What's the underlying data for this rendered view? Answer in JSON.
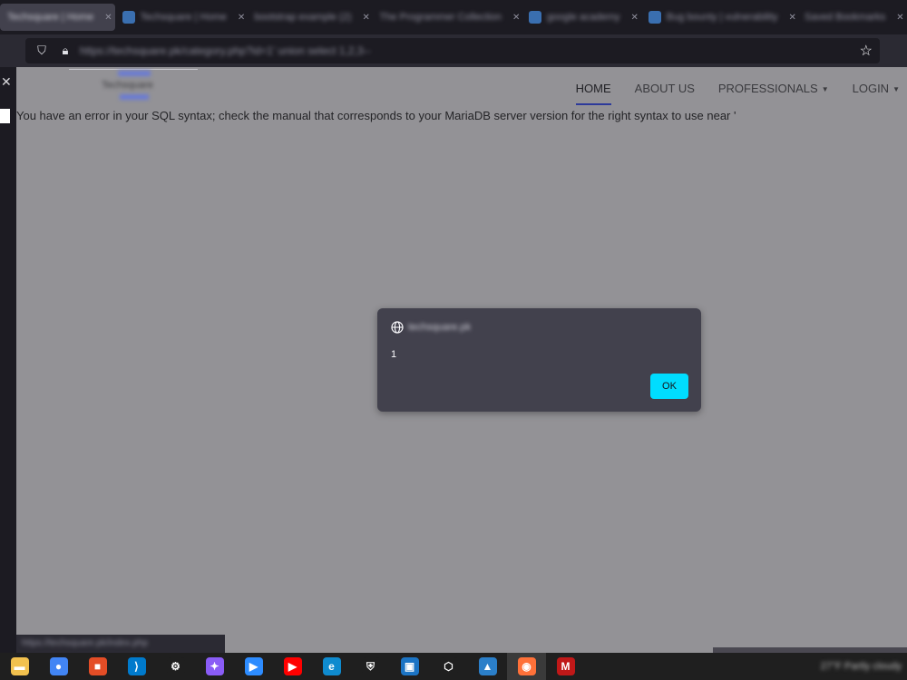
{
  "browser": {
    "tabs": [
      {
        "label": "Techsquare | Home",
        "active": true
      },
      {
        "label": "Techsquare | Home",
        "active": false
      },
      {
        "label": "bootstrap example (2)",
        "active": false
      },
      {
        "label": "The Programmer Collection",
        "active": false
      },
      {
        "label": "google academy",
        "active": false
      },
      {
        "label": "Bug bounty | vulnerability",
        "active": false
      },
      {
        "label": "Saved Bookmarks",
        "active": false
      }
    ],
    "url": "https://techsquare.pk/category.php?id=1' union select 1,2,3--",
    "page_status_url": "https://techsquare.pk/index.php"
  },
  "site": {
    "logo_text": "Techsquare",
    "nav": [
      {
        "label": "HOME",
        "dropdown": false,
        "active": true
      },
      {
        "label": "ABOUT US",
        "dropdown": false,
        "active": false
      },
      {
        "label": "PROFESSIONALS",
        "dropdown": true,
        "active": false
      },
      {
        "label": "LOGIN",
        "dropdown": true,
        "active": false
      }
    ],
    "error_message": "You have an error in your SQL syntax; check the manual that corresponds to your MariaDB server version for the right syntax to use near '"
  },
  "alert": {
    "origin": "techsquare.pk",
    "message": "1",
    "ok_label": "OK"
  },
  "taskbar": {
    "apps": [
      {
        "name": "file-explorer",
        "glyph": "▬",
        "color": "#f2c14e"
      },
      {
        "name": "chrome",
        "glyph": "●",
        "color": "#4285f4"
      },
      {
        "name": "microsoft-store",
        "glyph": "■",
        "color": "#e44d26"
      },
      {
        "name": "vscode",
        "glyph": "⟩",
        "color": "#007acc"
      },
      {
        "name": "settings",
        "glyph": "⚙",
        "color": "#1f1f1f"
      },
      {
        "name": "messenger",
        "glyph": "✦",
        "color": "#8a5cf6"
      },
      {
        "name": "zoom",
        "glyph": "▶",
        "color": "#2d8cff"
      },
      {
        "name": "youtube",
        "glyph": "▶",
        "color": "#ff0000"
      },
      {
        "name": "edge",
        "glyph": "e",
        "color": "#0f8bcf"
      },
      {
        "name": "security",
        "glyph": "⛨",
        "color": "#1f1f1f"
      },
      {
        "name": "virtualbox",
        "glyph": "▣",
        "color": "#1c74c4"
      },
      {
        "name": "3d-viewer",
        "glyph": "⬡",
        "color": "#1f1f1f"
      },
      {
        "name": "photos",
        "glyph": "▲",
        "color": "#2b7fc9"
      },
      {
        "name": "firefox",
        "glyph": "◉",
        "color": "#ff7139"
      },
      {
        "name": "mcafee",
        "glyph": "M",
        "color": "#c01818"
      }
    ],
    "weather": "27°F Partly cloudy"
  }
}
